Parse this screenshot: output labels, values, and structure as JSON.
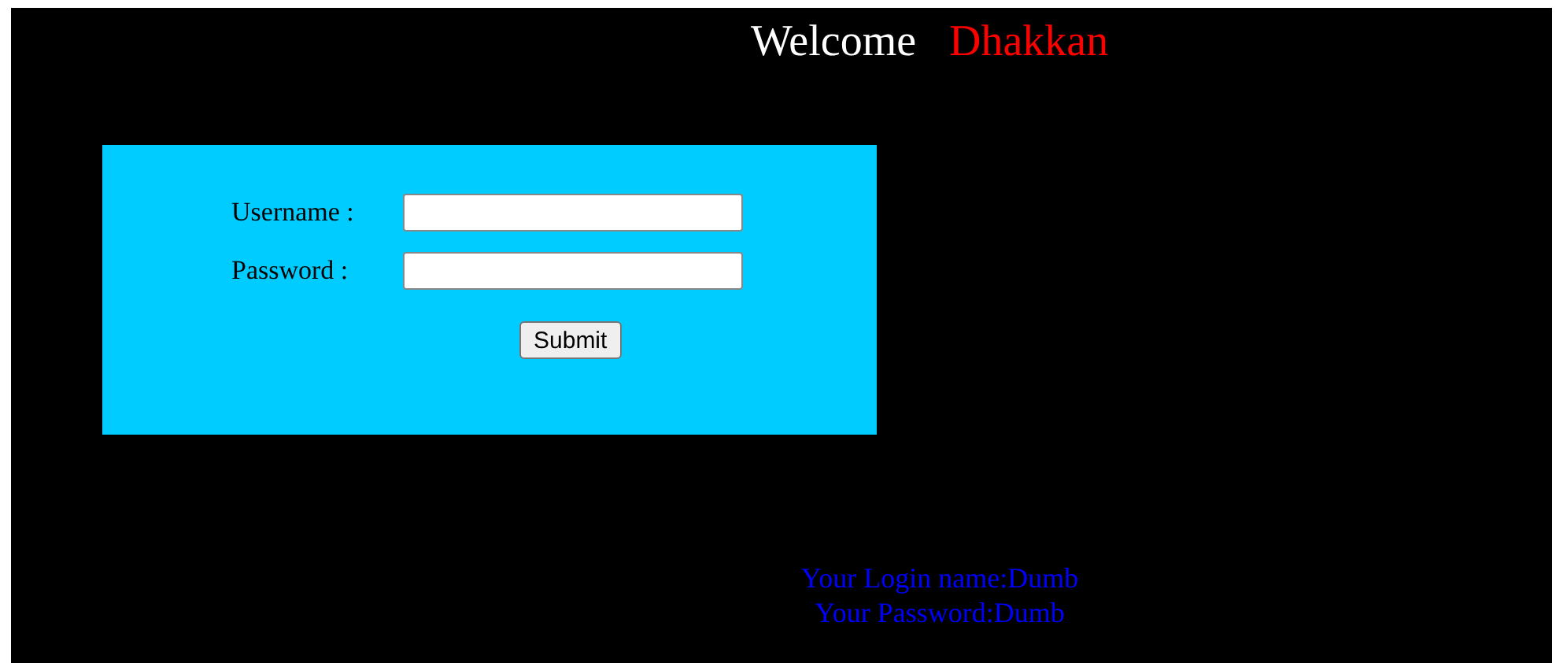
{
  "header": {
    "greeting": "Welcome",
    "name": "Dhakkan"
  },
  "form": {
    "fields": [
      {
        "label": "Username :"
      },
      {
        "label": "Password :"
      }
    ],
    "submit": "Submit"
  },
  "result": {
    "lines": [
      "Your Login name:Dumb",
      "Your Password:Dumb"
    ]
  }
}
